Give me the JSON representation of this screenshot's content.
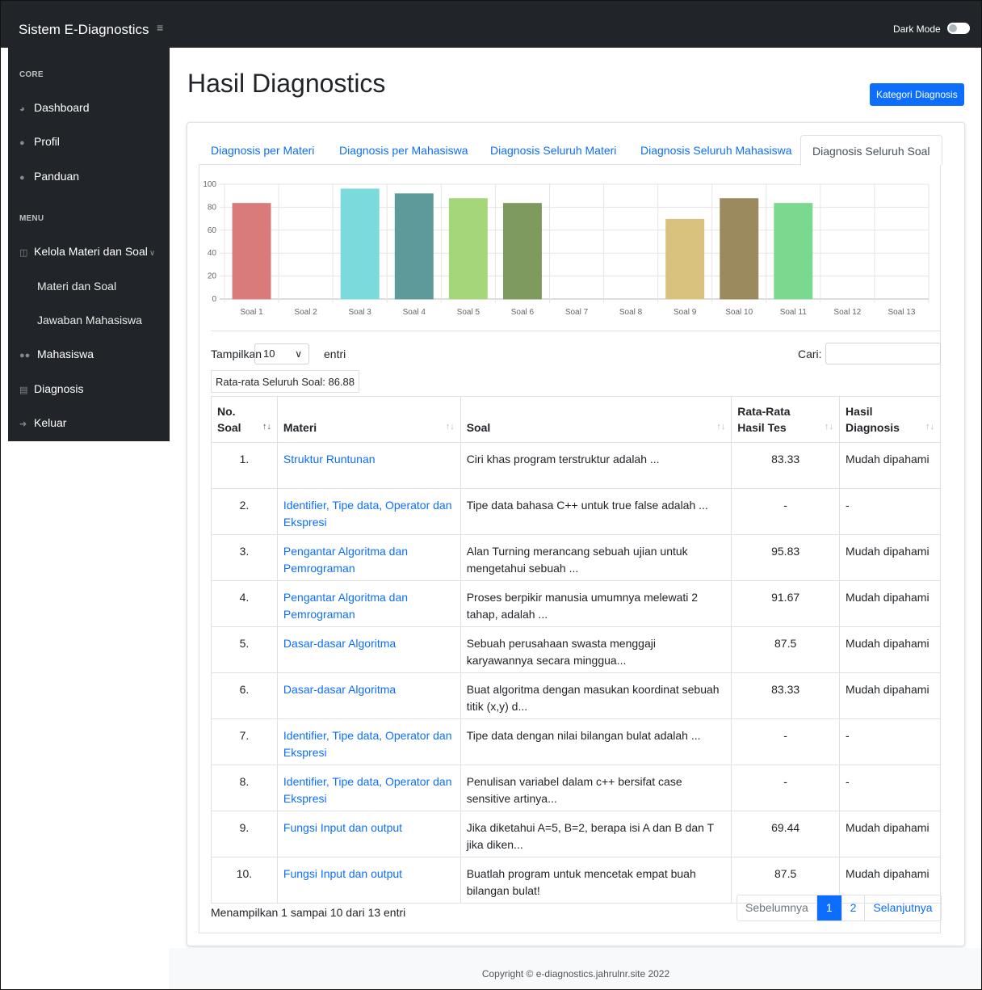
{
  "topbar": {
    "brand": "Sistem E-Diagnostics",
    "menu_icon": "hamburger-icon",
    "dark_mode_label": "Dark Mode"
  },
  "sidebar": {
    "core_heading": "CORE",
    "menu_heading": "MENU",
    "items": [
      {
        "label": "Dashboard",
        "icon": "dashboard-icon"
      },
      {
        "label": "Profil",
        "icon": "user-icon"
      },
      {
        "label": "Panduan",
        "icon": "info-icon"
      },
      {
        "label": "Kelola Materi dan Soal",
        "icon": "table-icon"
      },
      {
        "label": "Materi dan Soal"
      },
      {
        "label": "Jawaban Mahasiswa"
      },
      {
        "label": "Mahasiswa",
        "icon": "users-icon"
      },
      {
        "label": "Diagnosis",
        "icon": "chart-icon"
      },
      {
        "label": "Keluar",
        "icon": "sign-out-icon"
      }
    ]
  },
  "page": {
    "title": "Hasil Diagnostics",
    "kategori_button": "Kategori Diagnosis"
  },
  "tabs": [
    {
      "label": "Diagnosis per Materi"
    },
    {
      "label": "Diagnosis per Mahasiswa"
    },
    {
      "label": "Diagnosis Seluruh Materi"
    },
    {
      "label": "Diagnosis Seluruh Mahasiswa"
    },
    {
      "label": "Diagnosis Seluruh Soal",
      "active": true
    }
  ],
  "chart_data": {
    "type": "bar",
    "categories": [
      "Soal 1",
      "Soal 2",
      "Soal 3",
      "Soal 4",
      "Soal 5",
      "Soal 6",
      "Soal 7",
      "Soal 8",
      "Soal 9",
      "Soal 10",
      "Soal 11",
      "Soal 12",
      "Soal 13"
    ],
    "values": [
      83.33,
      null,
      95.83,
      91.67,
      87.5,
      83.33,
      null,
      null,
      69.44,
      87.5,
      83.33,
      null,
      null
    ],
    "colors": [
      "#d97b7b",
      null,
      "#7adadc",
      "#5e9a9a",
      "#a6d67a",
      "#7e9a5e",
      null,
      null,
      "#d9c27e",
      "#9b8a5e",
      "#7ad98f",
      null,
      null
    ],
    "ylim": [
      0,
      100
    ],
    "yticks": [
      0,
      20,
      40,
      60,
      80,
      100
    ],
    "grid": true
  },
  "table_controls": {
    "show_label": "Tampilkan",
    "length_value": "10",
    "entries_label": "entri",
    "search_label": "Cari:",
    "search_value": "",
    "average_text": "Rata-rata Seluruh Soal: 86.88"
  },
  "table": {
    "headers": {
      "no_line1": "No.",
      "no_line2": "Soal",
      "materi": "Materi",
      "soal": "Soal",
      "avg_line1": "Rata-Rata",
      "avg_line2": "Hasil Tes",
      "hasil_line1": "Hasil",
      "hasil_line2": "Diagnosis"
    },
    "rows": [
      {
        "no": "1.",
        "materi": "Struktur Runtunan",
        "soal": "Ciri khas program terstruktur adalah ...",
        "avg": "83.33",
        "hasil": "Mudah dipahami"
      },
      {
        "no": "2.",
        "materi": "Identifier, Tipe data, Operator dan Ekspresi",
        "soal": "Tipe data bahasa C++ untuk true false adalah ...",
        "avg": "-",
        "hasil": "-"
      },
      {
        "no": "3.",
        "materi": "Pengantar Algoritma dan Pemrograman",
        "soal": "Alan Turning merancang sebuah ujian untuk mengetahui sebuah ...",
        "avg": "95.83",
        "hasil": "Mudah dipahami"
      },
      {
        "no": "4.",
        "materi": "Pengantar Algoritma dan Pemrograman",
        "soal": "Proses berpikir manusia umumnya melewati 2 tahap, adalah ...",
        "avg": "91.67",
        "hasil": "Mudah dipahami"
      },
      {
        "no": "5.",
        "materi": "Dasar-dasar Algoritma",
        "soal": "Sebuah perusahaan swasta menggaji karyawannya secara minggua...",
        "avg": "87.5",
        "hasil": "Mudah dipahami"
      },
      {
        "no": "6.",
        "materi": "Dasar-dasar Algoritma",
        "soal": "Buat algoritma dengan masukan koordinat sebuah titik (x,y) d...",
        "avg": "83.33",
        "hasil": "Mudah dipahami"
      },
      {
        "no": "7.",
        "materi": "Identifier, Tipe data, Operator dan Ekspresi",
        "soal": "Tipe data dengan nilai bilangan bulat adalah ...",
        "avg": "-",
        "hasil": "-"
      },
      {
        "no": "8.",
        "materi": "Identifier, Tipe data, Operator dan Ekspresi",
        "soal": "Penulisan variabel dalam c++ bersifat case sensitive artinya...",
        "avg": "-",
        "hasil": "-"
      },
      {
        "no": "9.",
        "materi": "Fungsi Input dan output",
        "soal": "Jika diketahui A=5, B=2, berapa isi A dan B dan T jika diken...",
        "avg": "69.44",
        "hasil": "Mudah dipahami"
      },
      {
        "no": "10.",
        "materi": "Fungsi Input dan output",
        "soal": "Buatlah program untuk mencetak empat buah bilangan bulat!",
        "avg": "87.5",
        "hasil": "Mudah dipahami"
      }
    ]
  },
  "pagination": {
    "info": "Menampilkan 1 sampai 10 dari 13 entri",
    "prev": "Sebelumnya",
    "pages": [
      "1",
      "2"
    ],
    "current_page": "1",
    "next": "Selanjutnya"
  },
  "footer": {
    "copyright": "Copyright © e-diagnostics.jahrulnr.site 2022"
  }
}
